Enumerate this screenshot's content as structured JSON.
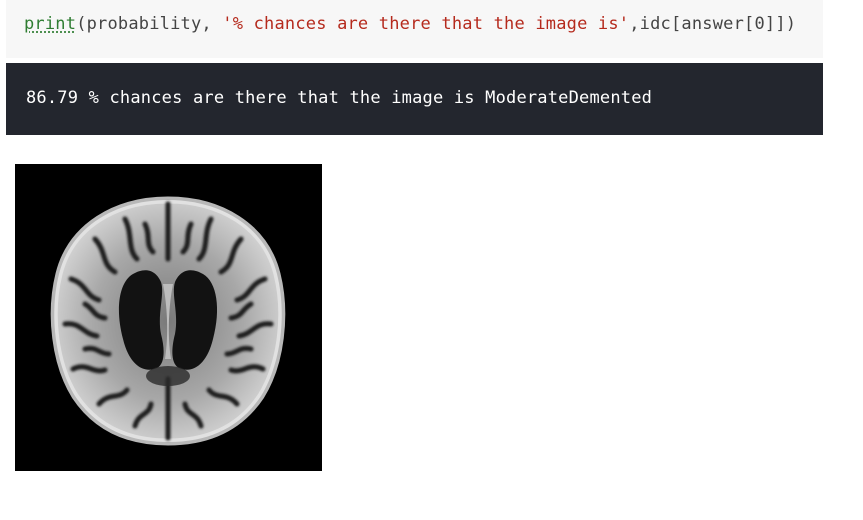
{
  "code_cell": {
    "builtin": "print",
    "args_open": "(probability, ",
    "string_literal": "'% chances are there that the image is'",
    "args_close": ",idc[answer[0]])"
  },
  "output_cell": {
    "text": "86.79 % chances are there that the image is ModerateDemented"
  },
  "output_image": {
    "icon": "brain-mri-scan-icon",
    "background_color": "#000000"
  },
  "colors": {
    "code_background": "#f7f7f7",
    "output_background": "#23262e",
    "builtin": "#2f7d32",
    "string": "#b52a1d"
  }
}
